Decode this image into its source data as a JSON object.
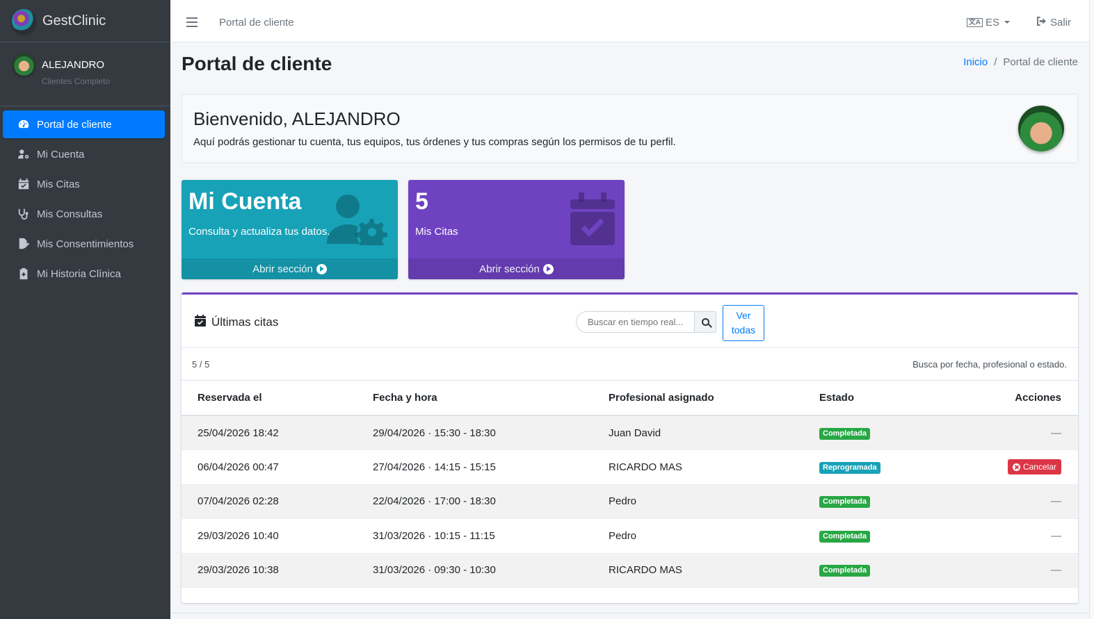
{
  "brand": {
    "name": "GestClinic"
  },
  "user": {
    "name": "ALEJANDRO",
    "role": "Clientes Completo"
  },
  "sidebar": {
    "items": [
      {
        "label": "Portal de cliente",
        "icon": "dashboard-icon",
        "active": true
      },
      {
        "label": "Mi Cuenta",
        "icon": "user-gear-icon",
        "active": false
      },
      {
        "label": "Mis Citas",
        "icon": "calendar-check-icon",
        "active": false
      },
      {
        "label": "Mis Consultas",
        "icon": "stethoscope-icon",
        "active": false
      },
      {
        "label": "Mis Consentimientos",
        "icon": "file-signature-icon",
        "active": false
      },
      {
        "label": "Mi Historia Clínica",
        "icon": "medical-file-icon",
        "active": false
      }
    ]
  },
  "topbar": {
    "title": "Portal de cliente",
    "language": "ES",
    "logout_label": "Salir"
  },
  "page": {
    "title": "Portal de cliente"
  },
  "breadcrumb": {
    "home": "Inicio",
    "separator": "/",
    "current": "Portal de cliente"
  },
  "welcome": {
    "heading": "Bienvenido, ALEJANDRO",
    "text": "Aquí podrás gestionar tu cuenta, tus equipos, tus órdenes y tus compras según los permisos de tu perfil."
  },
  "boxes": [
    {
      "title": "Mi Cuenta",
      "text": "Consulta y actualiza tus datos.",
      "footer": "Abrir sección",
      "color": "#17a2b8"
    },
    {
      "title": "5",
      "text": "Mis Citas",
      "footer": "Abrir sección",
      "color": "#6f42c1"
    }
  ],
  "appointments": {
    "title": "Últimas citas",
    "search_placeholder": "Buscar en tiempo real...",
    "view_all_line1": "Ver",
    "view_all_line2": "todas",
    "count": "5 / 5",
    "hint": "Busca por fecha, profesional o estado.",
    "columns": [
      "Reservada el",
      "Fecha y hora",
      "Profesional asignado",
      "Estado",
      "Acciones"
    ],
    "rows": [
      {
        "reserved": "25/04/2026 18:42",
        "datetime": "29/04/2026 · 15:30 - 18:30",
        "professional": "Juan David",
        "status": "Completada",
        "action": "—"
      },
      {
        "reserved": "06/04/2026 00:47",
        "datetime": "27/04/2026 · 14:15 - 15:15",
        "professional": "RICARDO MAS",
        "status": "Reprogramada",
        "action": "Cancelar"
      },
      {
        "reserved": "07/04/2026 02:28",
        "datetime": "22/04/2026 · 17:00 - 18:30",
        "professional": "Pedro",
        "status": "Completada",
        "action": "—"
      },
      {
        "reserved": "29/03/2026 10:40",
        "datetime": "31/03/2026 · 10:15 - 11:15",
        "professional": "Pedro",
        "status": "Completada",
        "action": "—"
      },
      {
        "reserved": "29/03/2026 10:38",
        "datetime": "31/03/2026 · 09:30 - 10:30",
        "professional": "RICARDO MAS",
        "status": "Completada",
        "action": "—"
      }
    ]
  },
  "colors": {
    "primary": "#007bff",
    "sidebar": "#343a40",
    "success": "#28a745",
    "info": "#17a2b8",
    "danger": "#dc3545",
    "purple": "#6f42c1"
  }
}
